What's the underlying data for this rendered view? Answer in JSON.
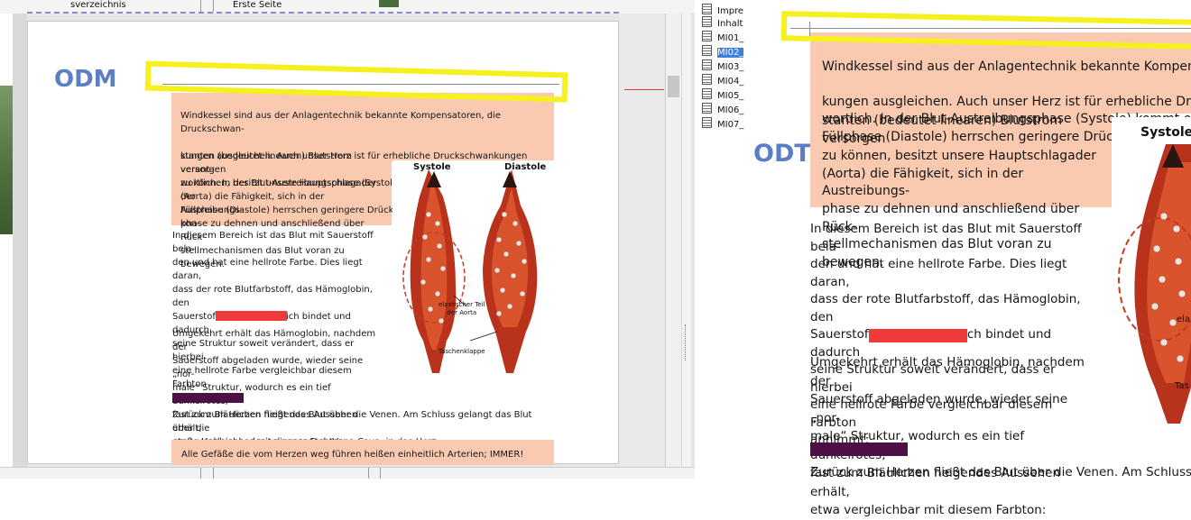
{
  "left": {
    "top_bar": {
      "toc_label": "sverzeichnis",
      "page_label": "Erste Seite"
    },
    "odm_label": "ODM",
    "intro_line1": "Windkessel sind aus der Anlagentechnik bekannte Kompensatoren, die Druckschwan-",
    "intro_lines": "kungen ausgleichen. Auch unser Herz ist für erhebliche Druckschwankungen verant-\nwortlich. In der Blut-Austreibungsphase (Systole) kommt es zu Druckspitzen, in der\nFüllphase (Diastole) herrschen geringere Drücke. Um unseren Körper mit einem kon-",
    "intro_lines2": "stanten (bedeutet linearen) Blutstrom versorgen\nzu können, besitzt unsere Hauptschlagader\n(Aorta) die Fähigkeit, sich in der Austreibungs-\nphase zu dehnen und anschließend über Rück-\nstellmechanismen das Blut voran zu bewegen.",
    "para1": "In diesem Bereich ist das Blut mit Sauerstoff bela-\nden und hat eine hellrote Farbe. Dies liegt daran,\ndass der rote Blutfarbstoff, das Hämoglobin, den\nSauerstoff chemisch an sich bindet und dadurch\nseine Struktur soweit verändert, dass er hierbei\neine hellrote Farbe vergleichbar diesem Farbton\nannimmt:",
    "para2": "Umgekehrt erhält das Hämoglobin, nachdem der\nSauerstoff abgeladen wurde, wieder seine „nor-\nmale“ Struktur, wodurch es ein tief dunkelrotes,\nfast zum Bläulichen neigendes Aussehen erhält,\netwa vergleichbar mit diesem Farbton:",
    "para3": "Zurück zum Herzen fließt das Blut über die Venen. Am Schluss gelangt das Blut über die\ngroße Hohlvene, der so genannten Vena Cava, in das Herz.",
    "footer": "Alle Gefäße die vom Herzen weg führen heißen einheitlich Arterien; IMMER!",
    "illustration": {
      "systole_label": "Systole",
      "diastole_label": "Diastole",
      "elastic_label": "elastischer Teil\nder Aorta",
      "valve_label": "Taschenklappe"
    }
  },
  "navigator": {
    "items": [
      {
        "label": "Impre"
      },
      {
        "label": "Inhalt"
      },
      {
        "label": "MI01_"
      },
      {
        "label": "MI02_"
      },
      {
        "label": "MI03_"
      },
      {
        "label": "MI04_"
      },
      {
        "label": "MI05_"
      },
      {
        "label": "MI06_"
      },
      {
        "label": "MI07_"
      }
    ],
    "selected_index": 3
  },
  "right": {
    "odt_label": "ODT",
    "intro_line1": "Windkessel sind aus der Anlagentechnik bekannte Kompensatoren, die",
    "intro_lines": "kungen ausgleichen. Auch unser Herz ist für erhebliche Druckschwankungen\nwortlich. In der Blut-Austreibungsphase (Systole) kommt es zu Druckspitzen\nFüllphase (Diastole) herrschen geringere Drücke. Um unseren Körper mit einem",
    "intro_lines2": "stanten (bedeutet linearen) Blutstrom versorgen\nzu können, besitzt unsere Hauptschlagader\n(Aorta) die Fähigkeit, sich in der Austreibungs-\nphase zu dehnen und anschließend über Rück-\nstellmechanismen das Blut voran zu bewegen.",
    "para1": "In diesem Bereich ist das Blut mit Sauerstoff bela-\nden und hat eine hellrote Farbe. Dies liegt daran,\ndass der rote Blutfarbstoff, das Hämoglobin, den\nSauerstoff chemisch an sich bindet und dadurch\nseine Struktur soweit verändert, dass er hierbei\neine hellrote Farbe vergleichbar diesem Farbton\nannimmt:",
    "para2": "Umgekehrt erhält das Hämoglobin, nachdem der\nSauerstoff abgeladen wurde, wieder seine „nor-\nmale“ Struktur, wodurch es ein tief dunkelrotes,\nfast zum Bläulichen neigendes Aussehen erhält,\netwa vergleichbar mit diesem Farbton:",
    "para3": "Zurück zum Herzen fließt das Blut über die Venen. Am Schluss gel",
    "illustration": {
      "systole_label": "Systole",
      "ela_label": "ela",
      "tas_label": "Tas"
    }
  },
  "colors": {
    "peach": "#f9c9b0",
    "oxygen_red": "#f03a3a",
    "deoxy_purple": "#4c1044",
    "label_blue": "#5b7ec4",
    "highlight_yellow": "#f6f01e"
  }
}
